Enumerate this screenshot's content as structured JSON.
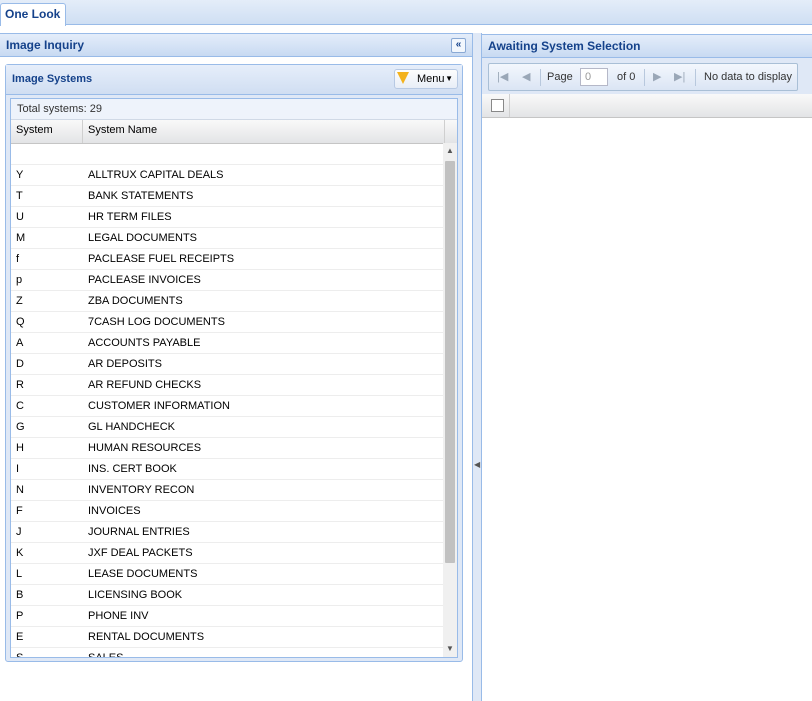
{
  "tabs": [
    {
      "label": "One Look"
    }
  ],
  "left": {
    "title": "Image Inquiry",
    "collapse_glyph": "«",
    "systems": {
      "title": "Image Systems",
      "menu_label": "Menu",
      "total_label": "Total systems: 29",
      "columns": [
        "System",
        "System Name"
      ],
      "rows": [
        [
          "Y",
          "ALLTRUX CAPITAL DEALS"
        ],
        [
          "T",
          "BANK STATEMENTS"
        ],
        [
          "U",
          "HR TERM FILES"
        ],
        [
          "M",
          "LEGAL DOCUMENTS"
        ],
        [
          "f",
          "PACLEASE FUEL RECEIPTS"
        ],
        [
          "p",
          "PACLEASE INVOICES"
        ],
        [
          "Z",
          "ZBA DOCUMENTS"
        ],
        [
          "Q",
          "7CASH LOG DOCUMENTS"
        ],
        [
          "A",
          "ACCOUNTS PAYABLE"
        ],
        [
          "D",
          "AR DEPOSITS"
        ],
        [
          "R",
          "AR REFUND CHECKS"
        ],
        [
          "C",
          "CUSTOMER INFORMATION"
        ],
        [
          "G",
          "GL HANDCHECK"
        ],
        [
          "H",
          "HUMAN RESOURCES"
        ],
        [
          "I",
          "INS. CERT BOOK"
        ],
        [
          "N",
          "INVENTORY RECON"
        ],
        [
          "F",
          "INVOICES"
        ],
        [
          "J",
          "JOURNAL ENTRIES"
        ],
        [
          "K",
          "JXF DEAL PACKETS"
        ],
        [
          "L",
          "LEASE DOCUMENTS"
        ],
        [
          "B",
          "LICENSING BOOK"
        ],
        [
          "P",
          "PHONE INV"
        ],
        [
          "E",
          "RENTAL DOCUMENTS"
        ],
        [
          "S",
          "SALES"
        ]
      ]
    }
  },
  "right": {
    "title": "Awaiting System Selection",
    "pager": {
      "page_label": "Page",
      "page_value": "0",
      "of_label": "of 0",
      "empty_msg": "No data to display"
    }
  }
}
